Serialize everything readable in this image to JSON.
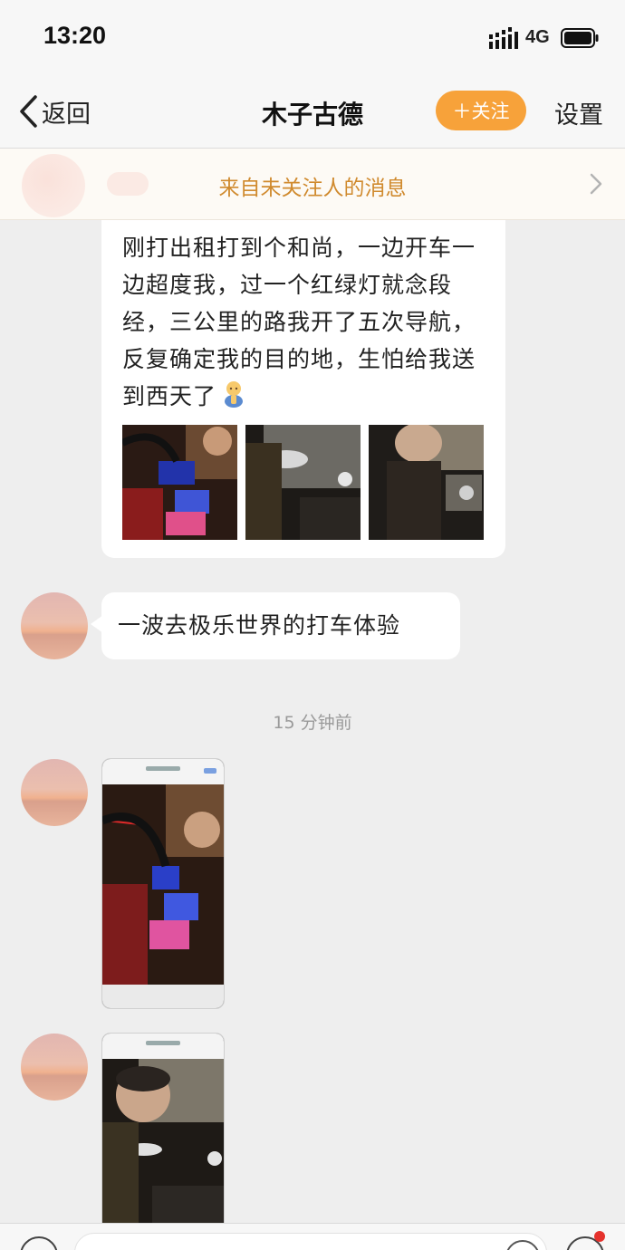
{
  "status_bar": {
    "time": "13:20",
    "network": "4G"
  },
  "nav": {
    "back_label": "返回",
    "title": "木子古德",
    "follow_label": "＋关注",
    "settings_label": "设置"
  },
  "notice": {
    "text": "来自未关注人的消息"
  },
  "messages": [
    {
      "type": "text_with_images",
      "text": "刚打出租打到个和尚，一边开车一边超度我，过一个红绿灯就念段经，三公里的路我开了五次导航，反复确定我的目的地，生怕给我送到西天了",
      "emoji": "praying-figure",
      "image_count": 3
    },
    {
      "type": "text",
      "text": "一波去极乐世界的打车体验"
    },
    {
      "type": "timestamp",
      "text": "15 分钟前"
    },
    {
      "type": "image",
      "description_icon": "screenshot-taxi-dashboard"
    },
    {
      "type": "image",
      "description_icon": "screenshot-taxi-driver"
    }
  ],
  "colors": {
    "accent": "#f7a23a",
    "notice_text": "#d08a2e",
    "background": "#eeeeee",
    "unread_dot": "#e5322d"
  }
}
